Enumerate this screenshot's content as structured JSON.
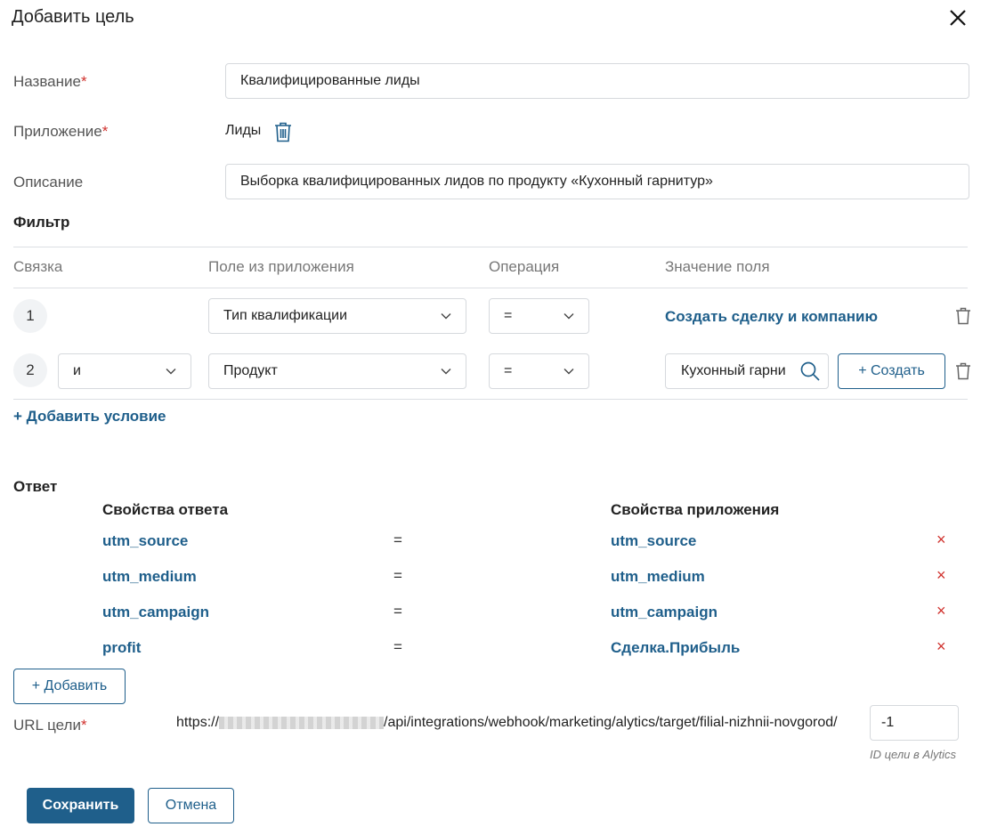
{
  "dialog": {
    "title": "Добавить цель"
  },
  "form": {
    "name_label": "Название",
    "name_value": "Квалифицированные лиды",
    "app_label": "Приложение",
    "app_value": "Лиды",
    "desc_label": "Описание",
    "desc_value": "Выборка квалифицированных лидов по продукту «Кухонный гарнитур»",
    "required_mark": "*"
  },
  "filter": {
    "title": "Фильтр",
    "columns": [
      "Связка",
      "Поле из приложения",
      "Операция",
      "Значение поля"
    ],
    "rows": [
      {
        "num": "1",
        "field": "Тип квалификации",
        "op": "=",
        "value_link": "Создать сделку и компанию"
      },
      {
        "num": "2",
        "link": "и",
        "field": "Продукт",
        "op": "=",
        "value": "Кухонный гарни",
        "create_label": "+ Создать"
      }
    ],
    "add_condition": "+ Добавить условие"
  },
  "response": {
    "title": "Ответ",
    "col_response": "Свойства ответа",
    "col_app": "Свойства приложения",
    "rows": [
      {
        "resp": "utm_source",
        "eq": "=",
        "app": "utm_source",
        "del": "×"
      },
      {
        "resp": "utm_medium",
        "eq": "=",
        "app": "utm_medium",
        "del": "×"
      },
      {
        "resp": "utm_campaign",
        "eq": "=",
        "app": "utm_campaign",
        "del": "×"
      },
      {
        "resp": "profit",
        "eq": "=",
        "app": "Сделка.Прибыль",
        "del": "×"
      }
    ],
    "add_label": "+ Добавить"
  },
  "url": {
    "label": "URL цели",
    "prefix": "https://",
    "path": "/api/integrations/webhook/marketing/alytics/target/filial-nizhnii-novgorod/",
    "id_value": "-1",
    "id_hint": "ID цели в Alytics"
  },
  "footer": {
    "save": "Сохранить",
    "cancel": "Отмена"
  },
  "colors": {
    "accent": "#1f5f8b",
    "required": "#d0312d",
    "delete": "#d0312d"
  }
}
